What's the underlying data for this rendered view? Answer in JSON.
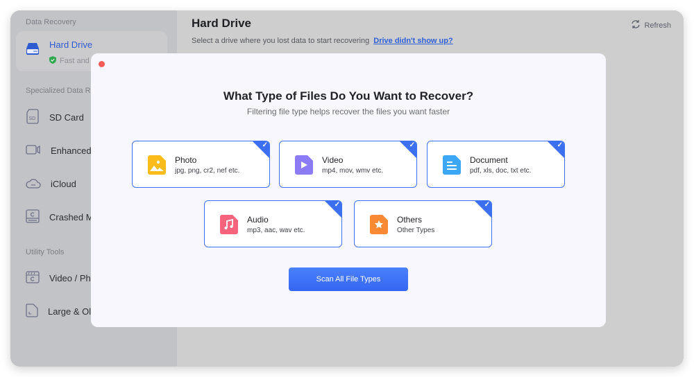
{
  "sidebar": {
    "data_recovery_label": "Data Recovery",
    "hard_drive": {
      "title": "Hard Drive",
      "subtitle": "Fast and"
    },
    "specialized_label": "Specialized Data Re",
    "specialized_items": [
      {
        "label": "SD Card",
        "icon": "sd-card-icon"
      },
      {
        "label": "Enhanced V",
        "icon": "video-camera-icon"
      },
      {
        "label": "iCloud",
        "icon": "cloud-icon"
      },
      {
        "label": "Crashed M",
        "icon": "crashed-mac-icon"
      }
    ],
    "utility_label": "Utility Tools",
    "utility_items": [
      {
        "label": "Video / Pho",
        "icon": "video-repair-icon"
      },
      {
        "label": "Large & Ol",
        "icon": "file-icon"
      }
    ]
  },
  "main": {
    "title": "Hard Drive",
    "subtitle": "Select a drive where you lost data to start recovering",
    "help_link": "Drive didn't show up?",
    "refresh_label": "Refresh"
  },
  "modal": {
    "title": "What Type of Files Do You Want to Recover?",
    "subtitle": "Filtering file type helps recover the files you want faster",
    "file_types": [
      {
        "name": "Photo",
        "desc": "jpg, png, cr2, nef etc.",
        "color": "#fbbc1b",
        "selected": true
      },
      {
        "name": "Video",
        "desc": "mp4, mov, wmv etc.",
        "color": "#8b7cf6",
        "selected": true
      },
      {
        "name": "Document",
        "desc": "pdf, xls, doc, txt etc.",
        "color": "#3ba7f5",
        "selected": true
      },
      {
        "name": "Audio",
        "desc": "mp3, aac, wav etc.",
        "color": "#f5637c",
        "selected": true
      },
      {
        "name": "Others",
        "desc": "Other Types",
        "color": "#f98a33",
        "selected": true
      }
    ],
    "scan_button": "Scan All File Types"
  },
  "colors": {
    "accent": "#3d70f0",
    "close": "#f35b55"
  }
}
